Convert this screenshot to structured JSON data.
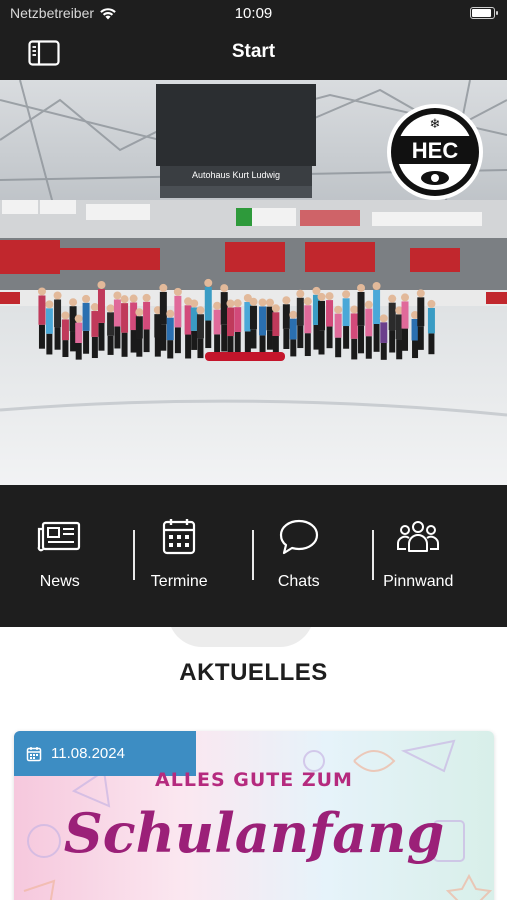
{
  "status_bar": {
    "carrier": "Netzbetreiber",
    "time": "10:09",
    "battery_level": 0.95
  },
  "nav": {
    "title": "Start",
    "menu_icon": "sidebar-panel-icon"
  },
  "hero": {
    "logo_text": "HEC",
    "banner_text": "Autohaus Kurt Ludwig"
  },
  "quick_nav": [
    {
      "label": "News",
      "icon": "newspaper-icon"
    },
    {
      "label": "Termine",
      "icon": "calendar-icon"
    },
    {
      "label": "Chats",
      "icon": "chat-bubble-icon"
    },
    {
      "label": "Pinnwand",
      "icon": "group-icon"
    }
  ],
  "section": {
    "title": "AKTUELLES"
  },
  "news": [
    {
      "date": "11.08.2024",
      "headline_small": "ALLES GUTE ZUM",
      "headline_big": "Schulanfang"
    }
  ],
  "colors": {
    "bar_bg": "#1e1e1e",
    "accent_blue": "#3d8dc3",
    "headline_magenta": "#9b2078"
  }
}
